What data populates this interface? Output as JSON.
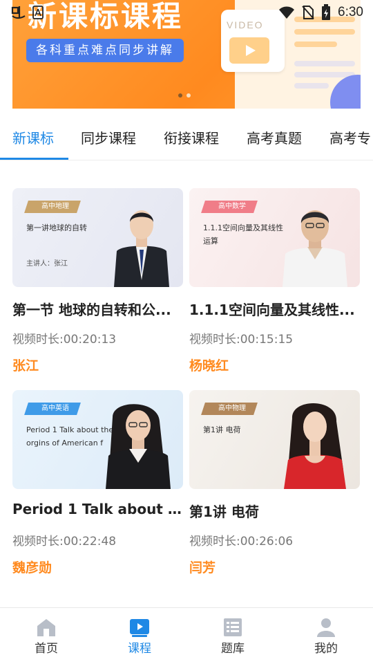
{
  "status_bar": {
    "time": "6:30"
  },
  "banner": {
    "title": "新课标课程",
    "subtitle": "各科重点难点同步讲解",
    "video_label": "VIDEO",
    "page_index": 1,
    "page_count": 2
  },
  "tabs": [
    {
      "label": "新课标"
    },
    {
      "label": "同步课程"
    },
    {
      "label": "衔接课程"
    },
    {
      "label": "高考真题"
    },
    {
      "label": "高考专"
    }
  ],
  "courses": [
    {
      "tag": "高中地理",
      "thumb_text": "第一讲地球的自转",
      "lecturer_line": "主讲人：张江",
      "title": "第一节 地球的自转和公...",
      "duration": "视频时长:00:20:13",
      "teacher": "张江"
    },
    {
      "tag": "高中数学",
      "thumb_text": "1.1.1空间向量及其线性运算",
      "title": "1.1.1空间向量及其线性...",
      "duration": "视频时长:00:15:15",
      "teacher": "杨晓红"
    },
    {
      "tag": "高中英语",
      "thumb_text": "Period 1 Talk about the orgins of American f",
      "title": "Period 1 Talk about the...",
      "duration": "视频时长:00:22:48",
      "teacher": "魏彦勋"
    },
    {
      "tag": "高中物理",
      "thumb_text": "第1讲 电荷",
      "title": "第1讲 电荷",
      "duration": "视频时长:00:26:06",
      "teacher": "闫芳"
    }
  ],
  "bottom_nav": [
    {
      "label": "首页",
      "icon": "home-icon"
    },
    {
      "label": "课程",
      "icon": "play-icon"
    },
    {
      "label": "题库",
      "icon": "list-icon"
    },
    {
      "label": "我的",
      "icon": "user-icon"
    }
  ],
  "colors": {
    "accent": "#1e88e5",
    "teacher": "#ff8a1f",
    "banner": "#ff8a1f"
  }
}
